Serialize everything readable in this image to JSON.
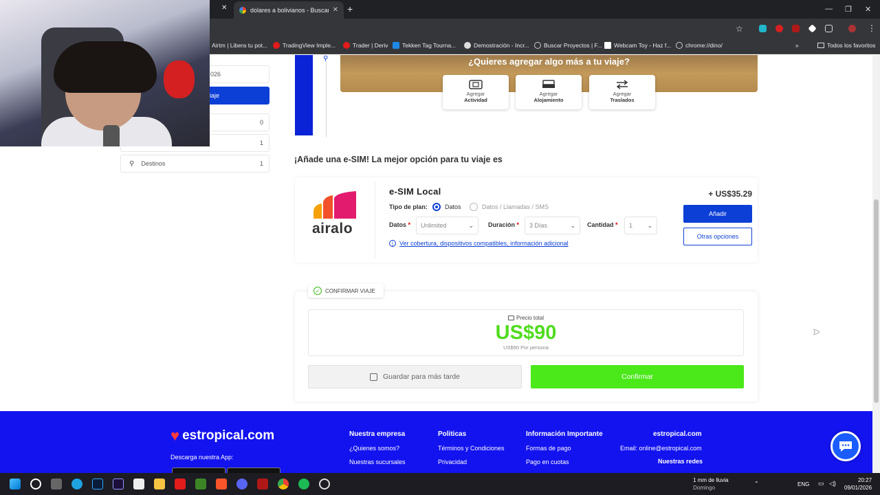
{
  "browser": {
    "active_tab_title": "dolares a bolivianos - Buscar co",
    "new_tab_label": "+",
    "bookmarks": [
      "Airtm | Libera tu pot...",
      "TradingView Imple...",
      "Trader | Deriv",
      "Tekken Tag Tourna...",
      "Demostración - Incr...",
      "Buscar Proyectos | F...",
      "Webcam Toy - Haz f...",
      "chrome://dino/"
    ],
    "all_bookmarks": "Todos los favoritos",
    "colors": {
      "frame": "#202124",
      "toolbar": "#35363a"
    }
  },
  "sidebar": {
    "date_partial": "026",
    "button_partial": "iaje",
    "rows": [
      {
        "label": "",
        "count": "0"
      },
      {
        "label": "",
        "count": "1"
      },
      {
        "label": "Destinos",
        "count": "1"
      }
    ]
  },
  "banner": {
    "title": "¿Quieres agregar algo más a tu viaje?",
    "cards": [
      {
        "line1": "Agregar",
        "line2": "Actividad",
        "icon": "ticket-icon"
      },
      {
        "line1": "Agregar",
        "line2": "Alojamiento",
        "icon": "bed-icon"
      },
      {
        "line1": "Agregar",
        "line2": "Traslados",
        "icon": "transfer-icon"
      }
    ]
  },
  "esim": {
    "heading": "¡Añade una e-SIM! La mejor opción para tu viaje es",
    "provider_logo_text": "airalo",
    "name": "e-SIM  Local",
    "price": "+ US$35.29",
    "plan_type_label": "Tipo de plan:",
    "plan_options": [
      "Datos",
      "Datos / Llamadas / SMS"
    ],
    "data_label": "Datos",
    "data_value": "Unlimited",
    "duration_label": "Duración",
    "duration_value": "3 Días",
    "quantity_label": "Cantidad",
    "quantity_value": "1",
    "coverage_link": "Ver cobertura, dispositivos compatibles, información adicional",
    "add_button": "Añadir",
    "more_button": "Otras opciones"
  },
  "confirm": {
    "badge": "CONFIRMAR VIAJE",
    "total_label": "Precio total",
    "total": "US$90",
    "per_person": "US$90 Por persona",
    "save_button": "Guardar para más tarde",
    "confirm_button": "Confirmar",
    "accent_color": "#4be81a"
  },
  "footer": {
    "logo": "estropical.com",
    "app_line": "Descarga nuestra App:",
    "columns": [
      {
        "title": "Nuestra empresa",
        "links": [
          "¿Quienes somos?",
          "Nuestras sucursales"
        ]
      },
      {
        "title": "Politicas",
        "links": [
          "Términos y Condiciones",
          "Privacidad"
        ]
      },
      {
        "title": "Información Importante",
        "links": [
          "Formas de pago",
          "Pago en cuotas"
        ]
      },
      {
        "title": "estropical.com",
        "links": [
          "Email: online@estropical.com",
          "Nuestras redes"
        ]
      }
    ],
    "brand_color": "#1313f0"
  },
  "taskbar": {
    "weather": "1 mm de lluvia",
    "weather_day": "Domingo",
    "lang": "ENG",
    "time": "20:27",
    "date": "09/01/2026"
  }
}
